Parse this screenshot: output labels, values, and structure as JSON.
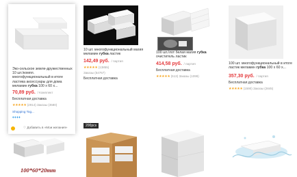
{
  "products": [
    {
      "title_pre": "Эко-сельское земле-дружественных 10 шт./компл. многофункциональный в итоге ластика аксессуары для дома меламин ",
      "title_bold": "губка",
      "title_post": " 100 x 60 x...",
      "price": "70,89 руб.",
      "unit": "/ Комплект",
      "free": "Бесплатная доставка",
      "stars": "★★★★★",
      "rating": "(2914)",
      "orders": "Заказы (3580)",
      "shop": "Shopping Tog...",
      "gems": "♦♦♦♦",
      "wishlist": "Добавить в «Мои желания»"
    },
    {
      "title_pre": "10 шт. многофункциональный магия меламин ",
      "title_bold": "губка",
      "title_post": " ластик",
      "price": "142,49 руб.",
      "unit": "/ партия",
      "stars": "★★★★★",
      "rating": "(13855)",
      "orders": "Заказы (54767)",
      "free": "Бесплатная доставка"
    },
    {
      "title_pre": "100 шт./лот белая магия ",
      "title_bold": "губка",
      "title_post": " очиститель ластик",
      "price": "414,58 руб.",
      "unit": "/ партия",
      "free": "Бесплатная доставка",
      "stars": "★★★★★",
      "rating": "(513)",
      "orders": "Заказы (1099)"
    },
    {
      "title_pre": "100 шт. многофункциональный в итоге ластик меламин ",
      "title_bold": "губка",
      "title_post": " 100 x 60 x...",
      "price": "357,30 руб.",
      "unit": "/ партия",
      "free": "Бесплатная доставка",
      "stars": "★★★★★",
      "rating": "(1590)",
      "orders": "Заказы (2845)"
    }
  ],
  "bottom_row": {
    "badge": "200pcs",
    "caption": "100*60*20mm"
  }
}
